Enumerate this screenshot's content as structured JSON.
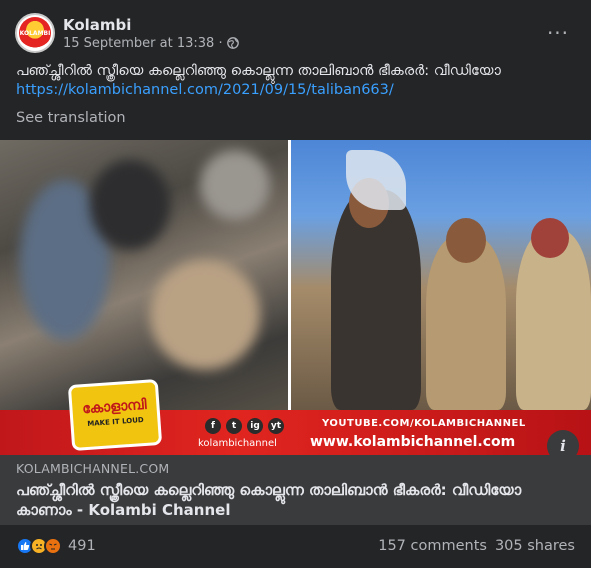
{
  "post": {
    "page_name": "Kolambi",
    "timestamp": "15 September at 13:38 ·",
    "text": "പഞ്ച്ശീറിൽ സ്ത്രീയെ കല്ലെറിഞ്ഞു കൊല്ലുന്ന താലിബാൻ ഭീകരർ: വീഡിയോ",
    "link": "https://kolambichannel.com/2021/09/15/taliban663/",
    "see_translation": "See translation",
    "more_label": "···"
  },
  "avatar": {
    "label": "KOLAMBI"
  },
  "media": {
    "logo_text": "കോളാമ്പി",
    "logo_sub": "MAKE IT LOUD",
    "social": [
      "f",
      "t",
      "ig",
      "yt"
    ],
    "handle": "kolambichannel",
    "youtube": "YOUTUBE.COM/KOLAMBICHANNEL",
    "website": "www.kolambichannel.com",
    "info_label": "i"
  },
  "link_preview": {
    "domain": "KOLAMBICHANNEL.COM",
    "title": "പഞ്ച്ശീറിൽ സ്ത്രീയെ കല്ലെറിഞ്ഞു കൊല്ലുന്ന താലിബാൻ ഭീകരർ: വീഡിയോ കാണാം - Kolambi Channel"
  },
  "stats": {
    "reactions": [
      "like-icon",
      "sad-icon",
      "angry-icon"
    ],
    "reaction_count": "491",
    "comments": "157 comments",
    "shares": "305 shares"
  },
  "colors": {
    "background": "#242526",
    "link": "#3aa0ff",
    "banner_red": "#e1251f",
    "like_blue": "#1877f2"
  }
}
